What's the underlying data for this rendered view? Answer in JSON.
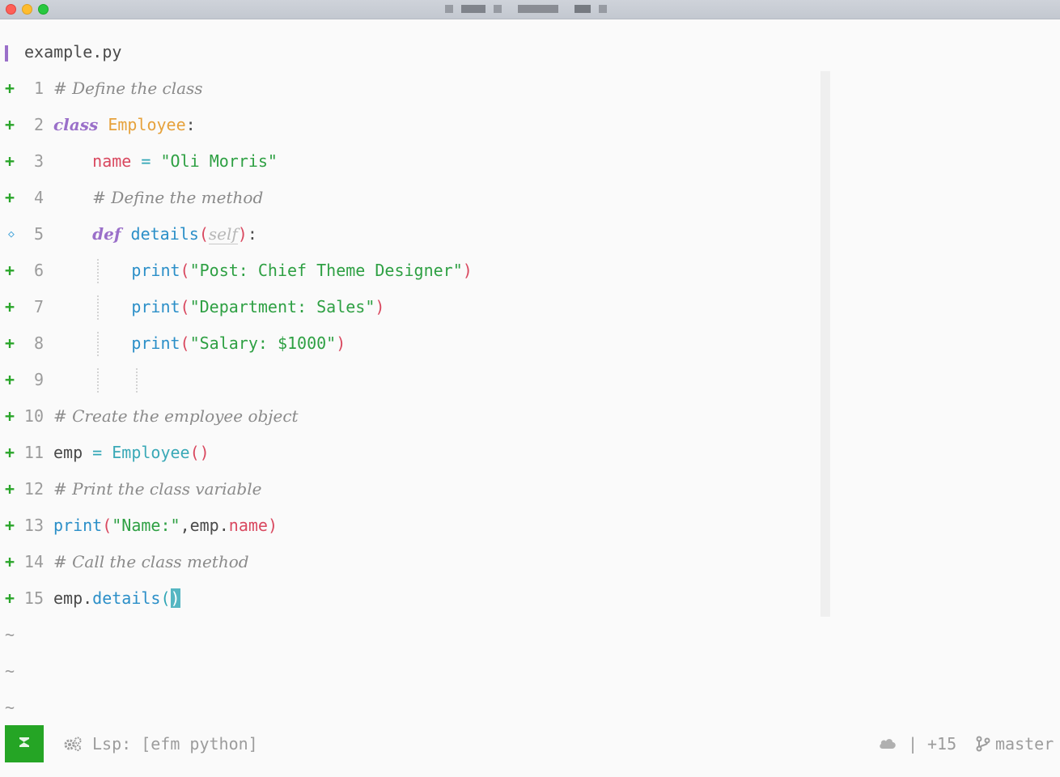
{
  "editor": {
    "filename": "example.py",
    "lines": [
      {
        "num": "1",
        "sign": "+",
        "tokens": [
          {
            "c": "comment",
            "t": "# Define the class"
          }
        ]
      },
      {
        "num": "2",
        "sign": "+",
        "tokens": [
          {
            "c": "kw",
            "t": "class"
          },
          {
            "c": "plain",
            "t": " "
          },
          {
            "c": "cls",
            "t": "Employee"
          },
          {
            "c": "plain",
            "t": ":"
          }
        ]
      },
      {
        "num": "3",
        "sign": "+",
        "tokens": [
          {
            "c": "plain",
            "t": "    "
          },
          {
            "c": "var",
            "t": "name"
          },
          {
            "c": "plain",
            "t": " "
          },
          {
            "c": "op",
            "t": "="
          },
          {
            "c": "plain",
            "t": " "
          },
          {
            "c": "str",
            "t": "\"Oli Morris\""
          }
        ]
      },
      {
        "num": "4",
        "sign": "+",
        "tokens": [
          {
            "c": "plain",
            "t": "    "
          },
          {
            "c": "comment",
            "t": "# Define the method"
          }
        ]
      },
      {
        "num": "5",
        "sign": "◇",
        "tokens": [
          {
            "c": "plain",
            "t": "    "
          },
          {
            "c": "kw",
            "t": "def"
          },
          {
            "c": "plain",
            "t": " "
          },
          {
            "c": "fn",
            "t": "details"
          },
          {
            "c": "paren",
            "t": "("
          },
          {
            "c": "self",
            "t": "self"
          },
          {
            "c": "paren",
            "t": ")"
          },
          {
            "c": "plain",
            "t": ":"
          }
        ]
      },
      {
        "num": "6",
        "sign": "+",
        "tokens": [
          {
            "c": "plain",
            "t": "        "
          },
          {
            "c": "fn",
            "t": "print"
          },
          {
            "c": "paren",
            "t": "("
          },
          {
            "c": "str",
            "t": "\"Post: Chief Theme Designer\""
          },
          {
            "c": "paren",
            "t": ")"
          }
        ]
      },
      {
        "num": "7",
        "sign": "+",
        "tokens": [
          {
            "c": "plain",
            "t": "        "
          },
          {
            "c": "fn",
            "t": "print"
          },
          {
            "c": "paren",
            "t": "("
          },
          {
            "c": "str",
            "t": "\"Department: Sales\""
          },
          {
            "c": "paren",
            "t": ")"
          }
        ]
      },
      {
        "num": "8",
        "sign": "+",
        "tokens": [
          {
            "c": "plain",
            "t": "        "
          },
          {
            "c": "fn",
            "t": "print"
          },
          {
            "c": "paren",
            "t": "("
          },
          {
            "c": "str",
            "t": "\"Salary: $1000\""
          },
          {
            "c": "paren",
            "t": ")"
          }
        ]
      },
      {
        "num": "9",
        "sign": "+",
        "tokens": []
      },
      {
        "num": "10",
        "sign": "+",
        "tokens": [
          {
            "c": "comment",
            "t": "# Create the employee object"
          }
        ]
      },
      {
        "num": "11",
        "sign": "+",
        "tokens": [
          {
            "c": "plain",
            "t": "emp "
          },
          {
            "c": "op",
            "t": "="
          },
          {
            "c": "plain",
            "t": " "
          },
          {
            "c": "ctor",
            "t": "Employee"
          },
          {
            "c": "paren",
            "t": "()"
          }
        ]
      },
      {
        "num": "12",
        "sign": "+",
        "tokens": [
          {
            "c": "comment",
            "t": "# Print the class variable"
          }
        ]
      },
      {
        "num": "13",
        "sign": "+",
        "tokens": [
          {
            "c": "fn",
            "t": "print"
          },
          {
            "c": "paren",
            "t": "("
          },
          {
            "c": "str",
            "t": "\"Name:\""
          },
          {
            "c": "plain",
            "t": ",emp."
          },
          {
            "c": "var",
            "t": "name"
          },
          {
            "c": "paren",
            "t": ")"
          }
        ]
      },
      {
        "num": "14",
        "sign": "+",
        "tokens": [
          {
            "c": "comment",
            "t": "# Call the class method"
          }
        ]
      },
      {
        "num": "15",
        "sign": "+",
        "tokens": [
          {
            "c": "plain",
            "t": "emp."
          },
          {
            "c": "fn",
            "t": "details"
          },
          {
            "c": "op",
            "t": "("
          },
          {
            "c": "cursor",
            "t": ")"
          }
        ]
      }
    ],
    "empty_markers": [
      "~",
      "~",
      "~"
    ]
  },
  "statusline": {
    "lsp": "Lsp: [efm python]",
    "separator": "|",
    "diff_added": "+15",
    "branch": "master"
  },
  "colors": {
    "mode_bg": "#25a525",
    "git_add": "#2aa52a",
    "keyword": "#9a6fc9",
    "string": "#2ea043",
    "function": "#2b8fc8"
  }
}
